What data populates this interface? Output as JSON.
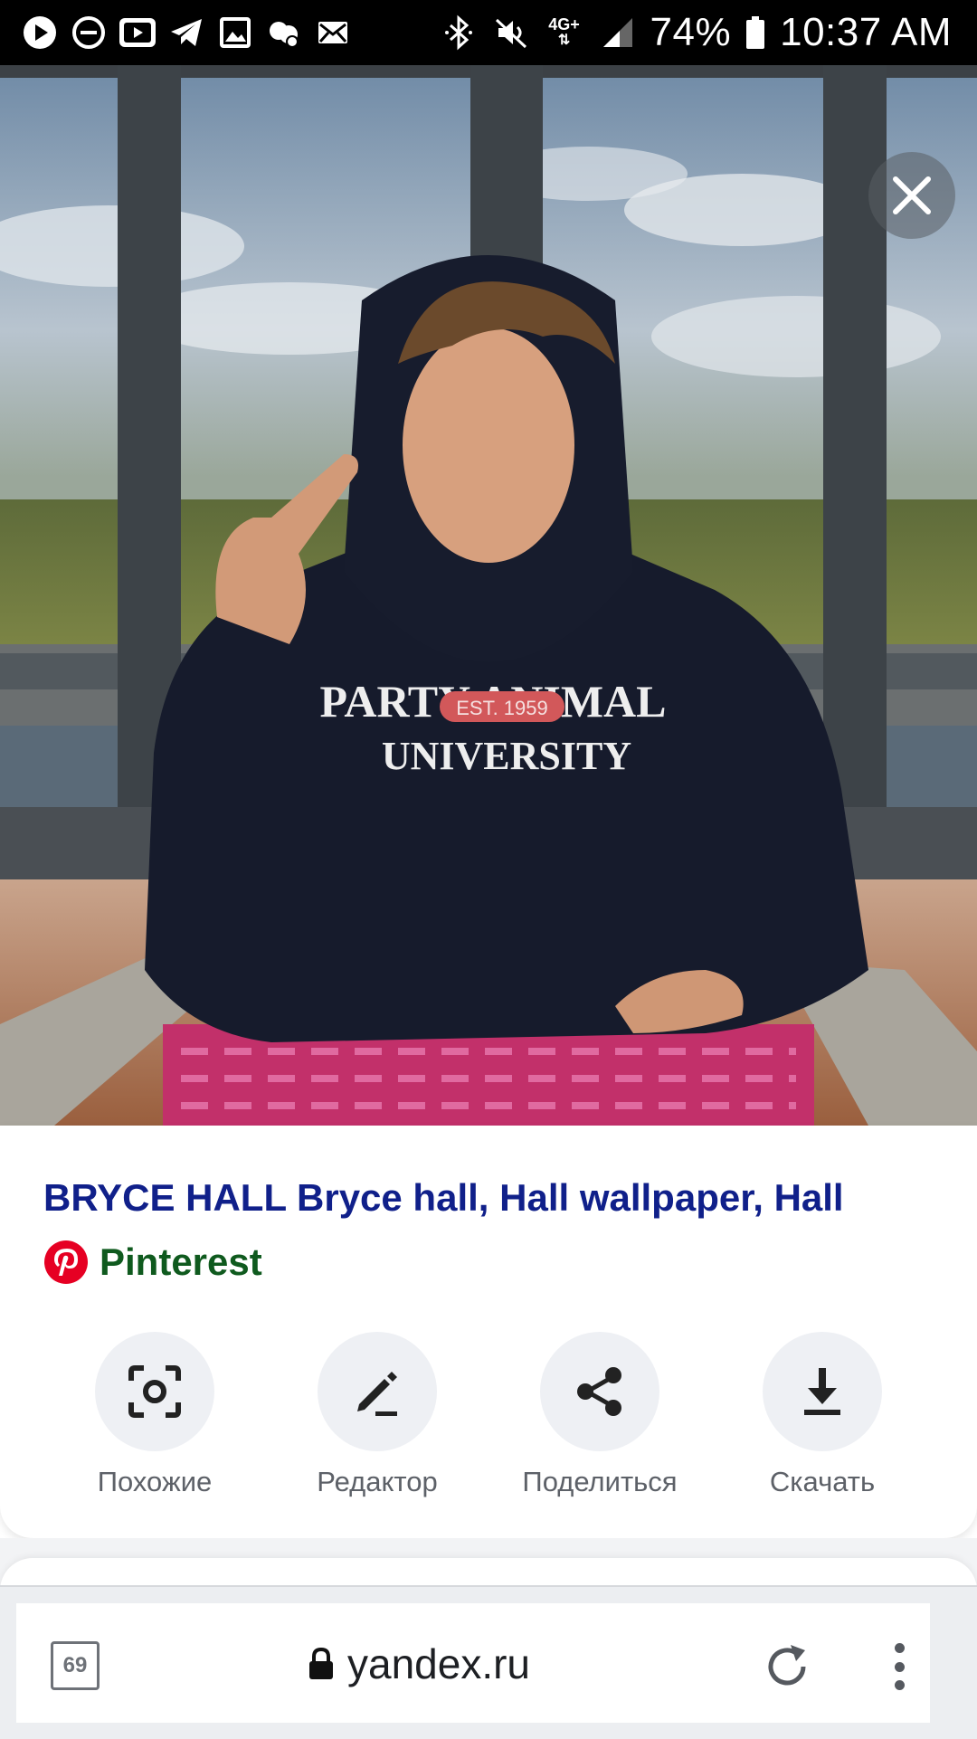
{
  "status_bar": {
    "left_icons": [
      "play-icon",
      "dnd-icon",
      "youtube-icon",
      "telegram-icon",
      "gallery-icon",
      "weather-icon",
      "mail-icon"
    ],
    "right_icons": [
      "bluetooth-icon",
      "mute-icon",
      "network-4g-icon",
      "signal-icon",
      "battery-icon"
    ],
    "network_type": "4G+",
    "battery": "74%",
    "time": "10:37 AM"
  },
  "photo": {
    "shirt_line1": "PARTY ANIMAL",
    "shirt_badge": "EST. 1959",
    "shirt_line2": "UNIVERSITY"
  },
  "result": {
    "title": "BRYCE HALL Bryce hall, Hall wallpaper, Hall",
    "source": "Pinterest",
    "title_color": "#10208a",
    "source_color": "#0f5a1e"
  },
  "actions": [
    {
      "label": "Похожие",
      "icon": "similar-scan-icon"
    },
    {
      "label": "Редактор",
      "icon": "pencil-icon"
    },
    {
      "label": "Поделиться",
      "icon": "share-icon"
    },
    {
      "label": "Скачать",
      "icon": "download-icon"
    }
  ],
  "browser": {
    "tab_count": "69",
    "url": "yandex.ru"
  }
}
